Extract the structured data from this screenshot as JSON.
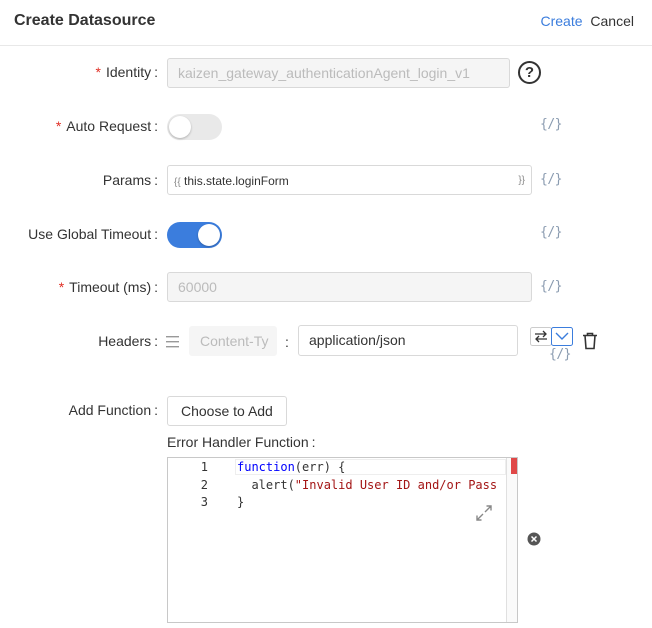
{
  "header": {
    "title": "Create Datasource",
    "create_label": "Create",
    "cancel_label": "Cancel"
  },
  "form": {
    "identity": {
      "label": "Identity",
      "value": "kaizen_gateway_authenticationAgent_login_v1",
      "help": "?"
    },
    "auto_request": {
      "label": "Auto Request",
      "state": "off"
    },
    "params": {
      "label": "Params",
      "open": "{{",
      "value": "this.state.loginForm",
      "close": "}}"
    },
    "use_global_timeout": {
      "label": "Use Global Timeout",
      "state": "on"
    },
    "timeout": {
      "label": "Timeout (ms)",
      "placeholder": "60000"
    },
    "headers": {
      "label": "Headers",
      "key_placeholder": "Content-Ty",
      "separator": ":",
      "value": "application/json"
    },
    "add_function": {
      "label": "Add Function",
      "button": "Choose to Add"
    },
    "error_handler": {
      "label": "Error Handler Function",
      "lines": [
        {
          "num": "1",
          "keyword": "function",
          "rest": "(err) {"
        },
        {
          "num": "2",
          "text": "  alert(",
          "string": "\"Invalid User ID and/or Pass"
        },
        {
          "num": "3",
          "text": "}"
        }
      ]
    }
  },
  "expr_toggle": "{/}",
  "icons": {
    "help": "question-circle-icon",
    "drag": "drag-handle-icon",
    "swap": "swap-icon",
    "dropdown": "chevron-down-icon",
    "delete": "trash-icon",
    "expand": "expand-icon",
    "remove": "close-circle-icon"
  },
  "colors": {
    "accent": "#3b7ddd",
    "required": "#e02e24",
    "keyword": "#0000ff",
    "string": "#a31515"
  }
}
